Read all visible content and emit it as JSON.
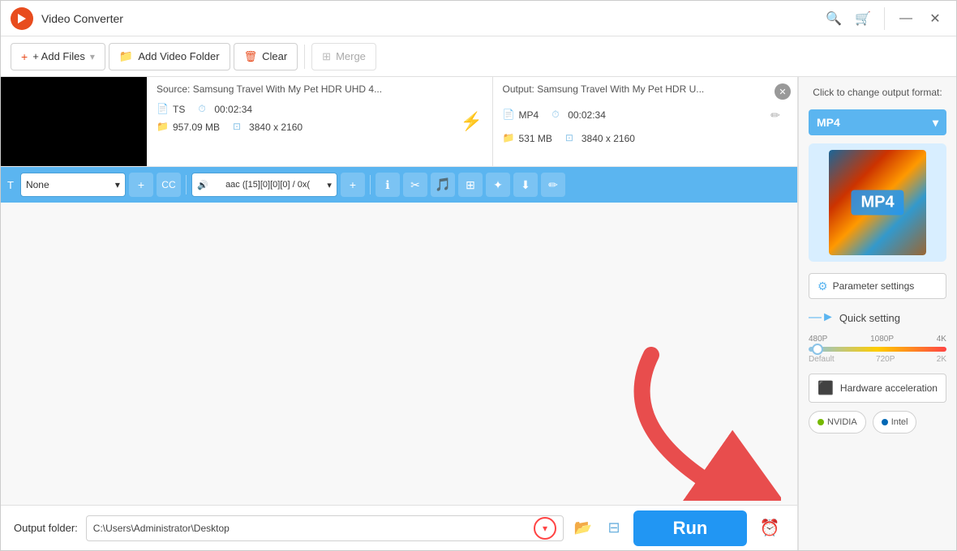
{
  "titlebar": {
    "title": "Video Converter",
    "minimize_label": "—",
    "close_label": "✕"
  },
  "toolbar": {
    "add_files_label": "+ Add Files",
    "add_folder_label": "Add Video Folder",
    "clear_label": "Clear",
    "merge_label": "Merge"
  },
  "file_row": {
    "source_label": "Source: Samsung Travel With My Pet HDR UHD 4...",
    "source_format": "TS",
    "source_duration": "00:02:34",
    "source_size": "957.09 MB",
    "source_resolution": "3840 x 2160",
    "output_label": "Output: Samsung Travel With My Pet HDR U...",
    "output_format": "MP4",
    "output_duration": "00:02:34",
    "output_size": "531 MB",
    "output_resolution": "3840 x 2160"
  },
  "edit_toolbar": {
    "subtitle_none": "None",
    "audio_track": "aac ([15][0][0][0] / 0x(",
    "icons": [
      "✚",
      "CC",
      "♪",
      "ℹ",
      "✂",
      "↺",
      "⊞",
      "✦",
      "⬇",
      "✏"
    ]
  },
  "bottom_bar": {
    "output_label": "Output folder:",
    "output_path": "C:\\Users\\Administrator\\Desktop",
    "run_label": "Run"
  },
  "right_panel": {
    "change_format_label": "Click to change output format:",
    "format_name": "MP4",
    "chevron_down": "▾",
    "param_settings_label": "Parameter settings",
    "quick_setting_label": "Quick setting",
    "quality_labels_top": [
      "480P",
      "1080P",
      "4K"
    ],
    "quality_labels_bottom": [
      "Default",
      "720P",
      "2K"
    ],
    "hw_accel_label": "Hardware acceleration",
    "nvidia_label": "NVIDIA",
    "intel_label": "Intel"
  }
}
